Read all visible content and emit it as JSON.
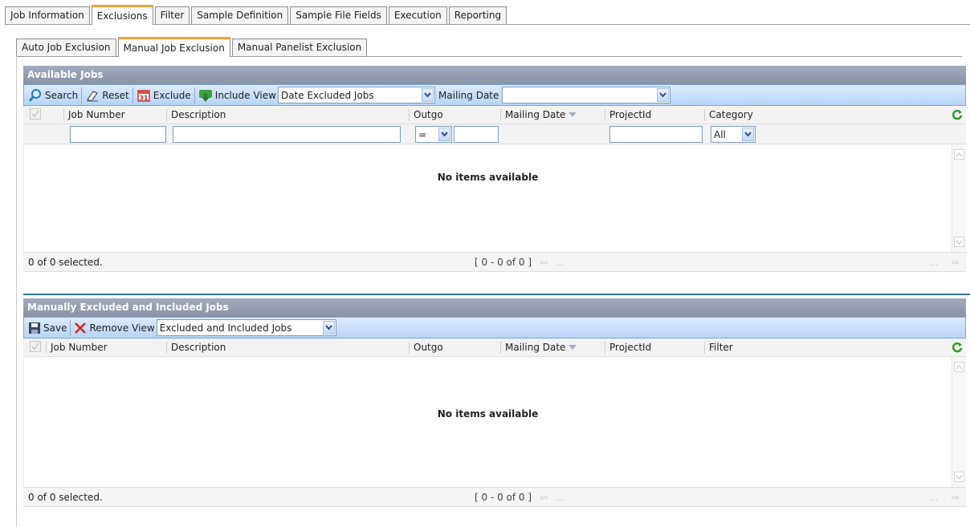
{
  "top_tabs": [
    {
      "label": "Job Information",
      "active": false
    },
    {
      "label": "Exclusions",
      "active": true
    },
    {
      "label": "Filter",
      "active": false
    },
    {
      "label": "Sample Definition",
      "active": false
    },
    {
      "label": "Sample File Fields",
      "active": false
    },
    {
      "label": "Execution",
      "active": false
    },
    {
      "label": "Reporting",
      "active": false
    }
  ],
  "sub_tabs": [
    {
      "label": "Auto Job Exclusion",
      "active": false
    },
    {
      "label": "Manual Job Exclusion",
      "active": true
    },
    {
      "label": "Manual Panelist Exclusion",
      "active": false
    }
  ],
  "available_jobs": {
    "header": "Available Jobs",
    "toolbar": {
      "search": "Search",
      "reset": "Reset",
      "exclude": "Exclude",
      "include": "Include",
      "view_label": "View",
      "view_value": "Date Excluded Jobs",
      "mailing_date_label": "Mailing Date",
      "mailing_date_value": ""
    },
    "columns": [
      "Job Number",
      "Description",
      "Outgo",
      "Mailing Date",
      "ProjectId",
      "Category"
    ],
    "filters": {
      "outgo_operator": "=",
      "category": "All"
    },
    "empty_message": "No items available",
    "footer": {
      "selected": "0 of 0 selected.",
      "pager": "[ 0 - 0 of 0 ]",
      "ellipsis": "...",
      "ellipsis_right": "..."
    }
  },
  "manual_jobs": {
    "header": "Manually Excluded and Included Jobs",
    "toolbar": {
      "save": "Save",
      "remove": "Remove",
      "view_label": "View",
      "view_value": "Excluded and Included Jobs"
    },
    "columns": [
      "Job Number",
      "Description",
      "Outgo",
      "Mailing Date",
      "ProjectId",
      "Filter"
    ],
    "empty_message": "No items available",
    "footer": {
      "selected": "0 of 0 selected.",
      "pager": "[ 0 - 0 of 0 ]",
      "ellipsis": "...",
      "ellipsis_right": "..."
    }
  },
  "colors": {
    "accent": "#f1a434",
    "header_bg": "#8a92a6",
    "toolbar_bg": "#b9d4f8",
    "divider": "#2f6ea8"
  }
}
